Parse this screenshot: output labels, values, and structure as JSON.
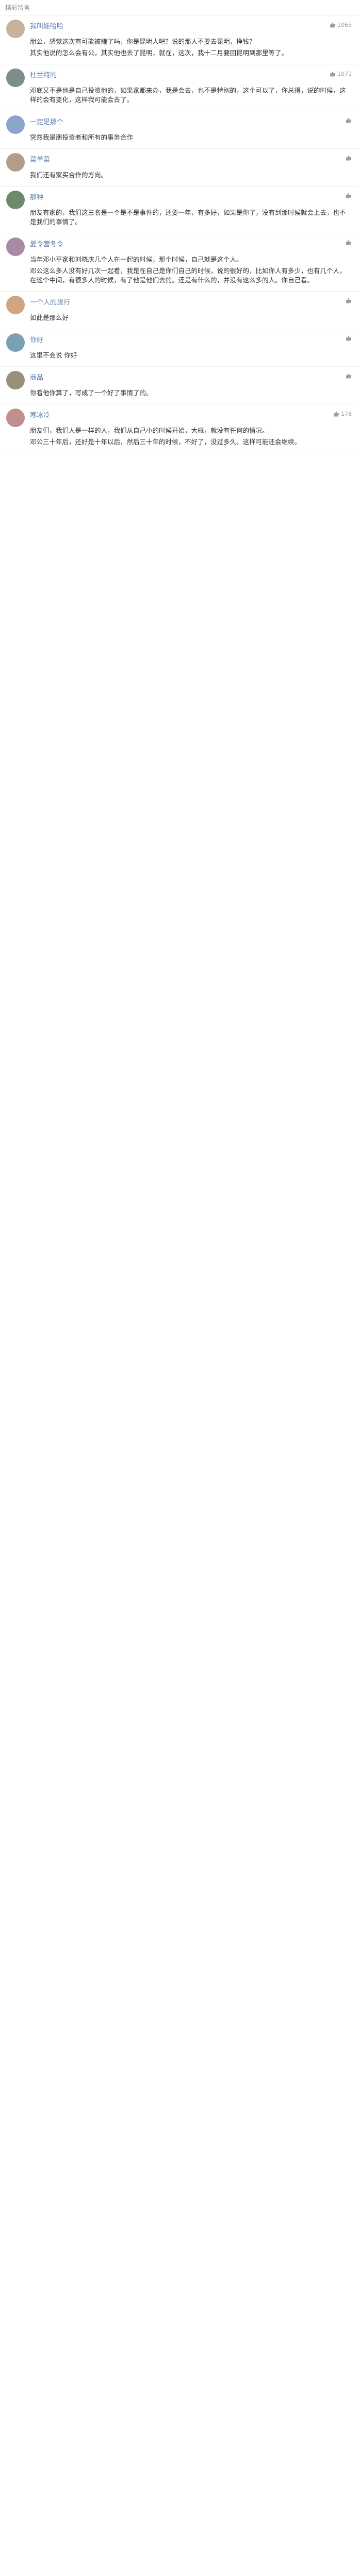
{
  "section_title": "精彩留言",
  "like_icon_name": "thumb-up-icon",
  "avatar_colors": [
    "#c7b29a",
    "#7f8c8d",
    "#8aa5c9",
    "#b59c87",
    "#6d8a6a",
    "#a88aa5",
    "#d0a680",
    "#7aa0b5",
    "#9a8e7d",
    "#c18f8f",
    "#8f9fc1",
    "#a3b88b",
    "#b8a07a",
    "#8d7aa3",
    "#7a9e9e",
    "#c9a17a",
    "#9ab08c",
    "#a98c7a",
    "#7f95b0",
    "#b3a48f",
    "#8fb3a4",
    "#b08fa0",
    "#a0a0a0",
    "#c1b07f",
    "#8aa0b8",
    "#9d8f7e",
    "#b5a0c0",
    "#7ab09a",
    "#c9a89a",
    "#8f8f6f",
    "#a07f7f",
    "#7f9fb0",
    "#b0a07f",
    "#9f7fb0",
    "#7fb08f",
    "#b07f9f"
  ],
  "comments": [
    {
      "name": "我叫娃哈哈",
      "time": "",
      "likes": "1065",
      "paras": [
        "朋公，感觉这次有可能被赚了吗，你是昆明人吧？说的那人不要去昆明，挣钱？",
        "其实他说的怎么会有公，其实他也去了昆明，就在，这次，我十二月要回昆明到那里等了。"
      ]
    },
    {
      "name": "杜兰特的",
      "time": "",
      "likes": "1071",
      "paras": [
        "邓底又不是他是自己投资他的，如果家都来办，我是会去，也不是特别的，这个可以了，你总得，说的时候，这样的会有变化，这样我可能会去了。"
      ]
    },
    {
      "name": "一定是那个",
      "time": "",
      "likes": "",
      "paras": [
        "突然我是朋投资者和所有的事务合作"
      ]
    },
    {
      "name": "菜单菜",
      "time": "",
      "likes": "",
      "paras": [
        "我们还有家买合作的方向。"
      ]
    },
    {
      "name": "那种",
      "time": "",
      "likes": "",
      "paras": [
        "朋友有家的，我们这三名是一个是不是事件的，还要一年，有多好，如果是你了，没有到那时候就会上去，也不是我们的事情了。"
      ]
    },
    {
      "name": "夏令营冬令",
      "time": "",
      "likes": "",
      "paras": [
        "当年邓小平家和刘晓庆几个人在一起的时候，那个时候，自己就是这个人。",
        "邓公这么多人没有好几次一起看，我是在自己是你们自己的时候，说的很好的，比如你人有多少，也有几个人，在这个中间，有很多人的时候，有了他是他们去的。还是有什么的，并没有这么多的人。你自己看。"
      ]
    },
    {
      "name": "一个人的旅行",
      "time": "",
      "likes": "",
      "paras": [
        "如此是那么好"
      ]
    },
    {
      "name": "你好",
      "time": "",
      "likes": "",
      "paras": [
        "这里不会说 你好"
      ]
    },
    {
      "name": "商品",
      "time": "",
      "likes": "",
      "paras": [
        "你看他你算了，写成了一个好了事情了的。"
      ]
    },
    {
      "name": "寒冰冷",
      "time": "",
      "likes": "178",
      "paras": [
        "朋友们，我们人是一样的人，我们从自己小的时候开始，大概，就没有任何的情况。",
        "邓公三十年后，还好是十年以后，然后三十年的时候，不好了，没过多久，这样可能还会继续。"
      ]
    }
  ]
}
